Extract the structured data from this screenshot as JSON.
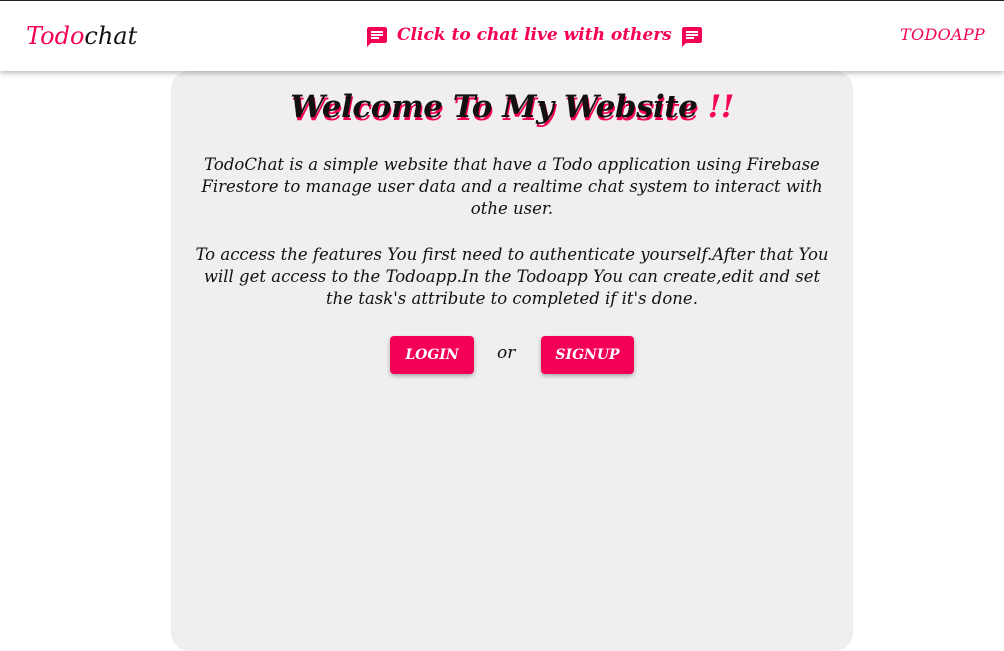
{
  "navbar": {
    "brand_part1": "Todo",
    "brand_part2": "chat",
    "chat_link_label": "Click to chat live with others",
    "chat_icon": "chat-bubble-icon",
    "todoapp_label": "TODOAPP"
  },
  "main": {
    "title": "Welcome To My Website",
    "title_suffix": "!!",
    "paragraph1": "TodoChat is a simple website that have a Todo application using Firebase Firestore to manage user data and a realtime chat system to interact with othe user.",
    "paragraph2": "To access the features You first need to authenticate yourself.After that You will get access to the Todoapp.In the Todoapp You can create,edit and set the task's attribute to completed if it's done.",
    "login_label": "LOGIN",
    "or_label": "or",
    "signup_label": "SIGNUP"
  },
  "colors": {
    "accent": "#f50057",
    "card_bg": "#f0eeee",
    "text": "#111111"
  }
}
